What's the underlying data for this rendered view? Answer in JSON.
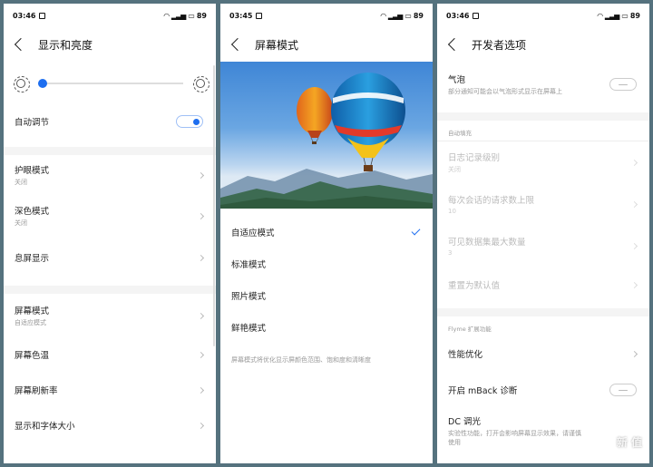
{
  "screens": [
    {
      "status": {
        "time": "03:46",
        "battery": "89"
      },
      "title": "显示和亮度",
      "brightness_level": 0.0,
      "auto_adjust": {
        "label": "自动调节",
        "on": true
      },
      "items": [
        {
          "label": "护眼模式",
          "sub": "关闭"
        },
        {
          "label": "深色模式",
          "sub": "关闭"
        },
        {
          "label": "息屏显示",
          "sub": ""
        },
        {
          "label": "屏幕模式",
          "sub": "自适应模式"
        },
        {
          "label": "屏幕色温",
          "sub": ""
        },
        {
          "label": "屏幕刷新率",
          "sub": ""
        },
        {
          "label": "显示和字体大小",
          "sub": ""
        }
      ]
    },
    {
      "status": {
        "time": "03:45",
        "battery": "89"
      },
      "title": "屏幕模式",
      "modes": [
        {
          "label": "自适应模式",
          "selected": true
        },
        {
          "label": "标准模式",
          "selected": false
        },
        {
          "label": "照片模式",
          "selected": false
        },
        {
          "label": "鲜艳模式",
          "selected": false
        }
      ],
      "description": "屏幕模式将优化显示屏颜色范围、饱和度和清晰度"
    },
    {
      "status": {
        "time": "03:46",
        "battery": "89"
      },
      "title": "开发者选项",
      "bubble": {
        "label": "气泡",
        "sub": "部分通知可能会以气泡形式显示在屏幕上",
        "on": false
      },
      "autofill_section": "自动填充",
      "autofill_items": [
        {
          "label": "日志记录级别",
          "sub": "关闭"
        },
        {
          "label": "每次会话的请求数上限",
          "sub": "10"
        },
        {
          "label": "可见数据集最大数量",
          "sub": "3"
        },
        {
          "label": "重置为默认值",
          "sub": ""
        }
      ],
      "flyme_section": "Flyme 扩展功能",
      "perf": {
        "label": "性能优化"
      },
      "mback": {
        "label": "开启 mBack 诊断",
        "on": false
      },
      "dc": {
        "label": "DC 调光",
        "sub": "实验性功能，打开会影响屏幕显示效果，请谨慎使用"
      },
      "watermark": "新 值"
    }
  ],
  "accent_color": "#1d6ef0"
}
